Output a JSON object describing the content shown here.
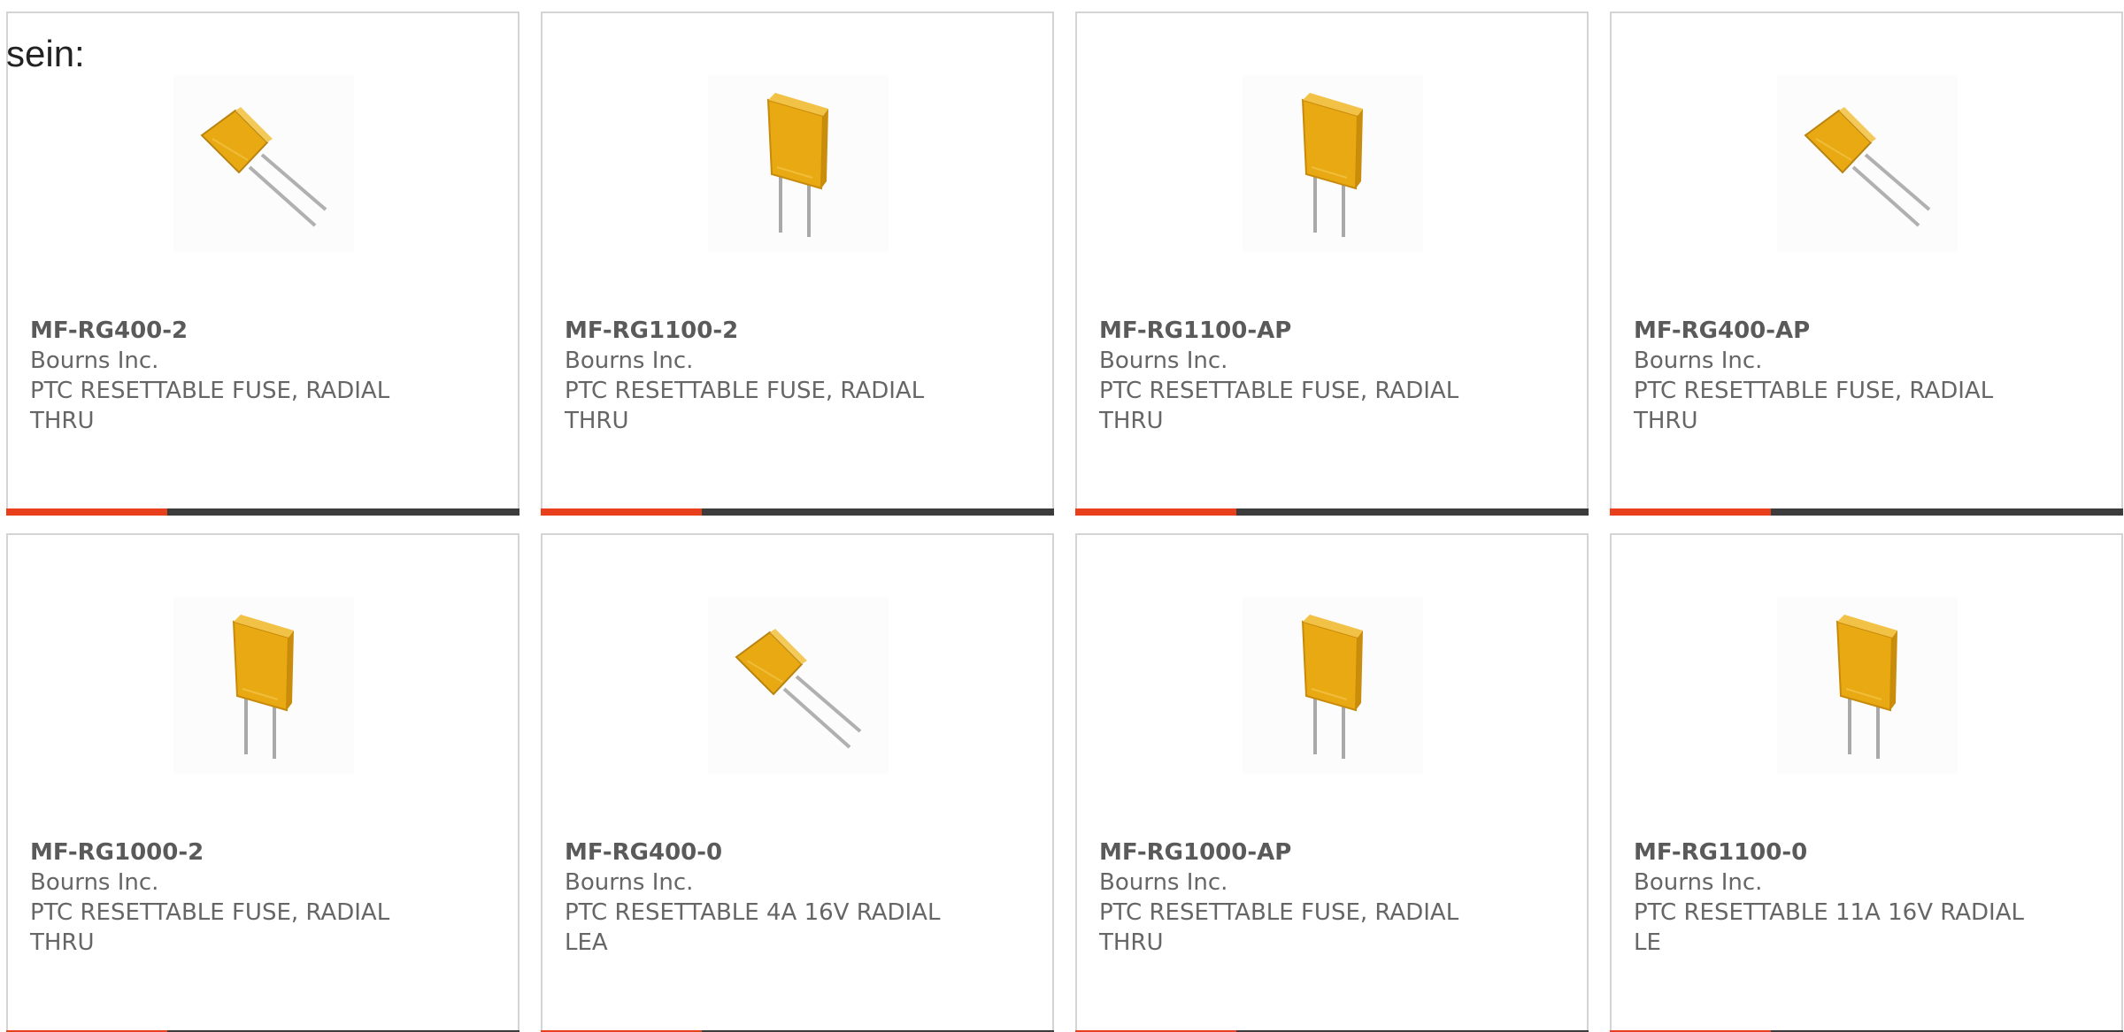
{
  "intro_text": "sein:",
  "colors": {
    "accent": "#e8401c",
    "bar_dark": "#3c3c3c",
    "card_border": "#d4d4d4",
    "text_gray": "#666666",
    "fuse_yellow": "#e8a912"
  },
  "products": [
    {
      "part": "MF-RG400-2",
      "manufacturer": "Bourns Inc.",
      "description": "PTC RESETTABLE FUSE, RADIAL THRU",
      "image_icon": "fuse-angled-icon"
    },
    {
      "part": "MF-RG1100-2",
      "manufacturer": "Bourns Inc.",
      "description": "PTC RESETTABLE FUSE, RADIAL THRU",
      "image_icon": "fuse-upright-icon"
    },
    {
      "part": "MF-RG1100-AP",
      "manufacturer": "Bourns Inc.",
      "description": "PTC RESETTABLE FUSE, RADIAL THRU",
      "image_icon": "fuse-upright-icon"
    },
    {
      "part": "MF-RG400-AP",
      "manufacturer": "Bourns Inc.",
      "description": "PTC RESETTABLE FUSE, RADIAL THRU",
      "image_icon": "fuse-angled-icon"
    },
    {
      "part": "MF-RG1000-2",
      "manufacturer": "Bourns Inc.",
      "description": "PTC RESETTABLE FUSE, RADIAL THRU",
      "image_icon": "fuse-upright-icon"
    },
    {
      "part": "MF-RG400-0",
      "manufacturer": "Bourns Inc.",
      "description": "PTC RESETTABLE 4A 16V RADIAL LEA",
      "image_icon": "fuse-angled-icon"
    },
    {
      "part": "MF-RG1000-AP",
      "manufacturer": "Bourns Inc.",
      "description": "PTC RESETTABLE FUSE, RADIAL THRU",
      "image_icon": "fuse-upright-icon"
    },
    {
      "part": "MF-RG1100-0",
      "manufacturer": "Bourns Inc.",
      "description": "PTC RESETTABLE 11A 16V RADIAL LE",
      "image_icon": "fuse-upright-icon"
    }
  ]
}
